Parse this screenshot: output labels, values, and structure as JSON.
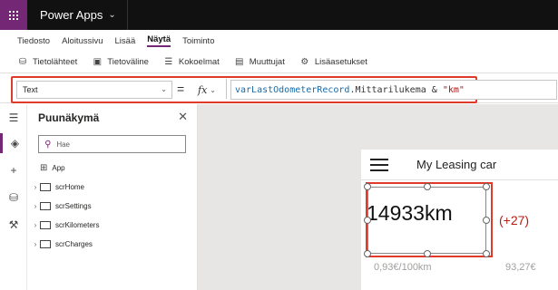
{
  "topbar": {
    "app_name": "Power Apps",
    "chevron": "⌄"
  },
  "menu": {
    "items": [
      "Tiedosto",
      "Aloitussivu",
      "Lisää",
      "Näytä",
      "Toiminto"
    ],
    "active_index": 3
  },
  "toolbar": {
    "items": [
      {
        "label": "Tietolähteet",
        "icon": "database-icon"
      },
      {
        "label": "Tietoväline",
        "icon": "media-icon"
      },
      {
        "label": "Kokoelmat",
        "icon": "collections-icon"
      },
      {
        "label": "Muuttujat",
        "icon": "variables-icon"
      },
      {
        "label": "Lisäasetukset",
        "icon": "advanced-settings-icon"
      }
    ]
  },
  "formula_bar": {
    "property": "Text",
    "equals": "=",
    "fx": "fx",
    "formula_var": "varLastOdometerRecord",
    "formula_dot": ".",
    "formula_field": "Mittarilukema",
    "formula_op": " & ",
    "formula_str": "\"km\""
  },
  "tree": {
    "title": "Puunäkymä",
    "search_placeholder": "Hae",
    "app_label": "App",
    "screens": [
      "scrHome",
      "scrSettings",
      "scrKilometers",
      "scrCharges"
    ]
  },
  "canvas": {
    "header_title": "My Leasing car",
    "odometer": "14933km",
    "delta": "(+27)",
    "consumption": "0,93€/100km",
    "cost": "93,27€"
  },
  "colors": {
    "brand": "#742774",
    "highlight": "#e03a2b",
    "delta_red": "#b81d13",
    "formula_var": "#1a6aa8",
    "formula_string": "#a31515"
  }
}
